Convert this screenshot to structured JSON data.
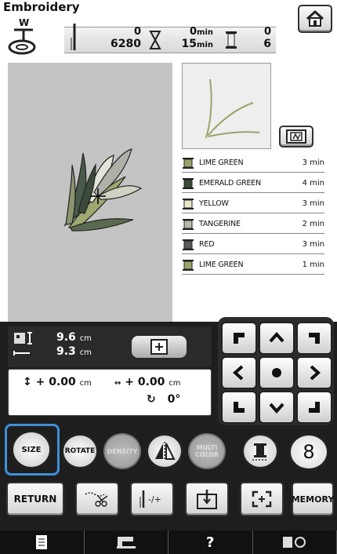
{
  "title": "Embroidery",
  "foot_label": "W",
  "status": {
    "stitch_current": "0",
    "stitch_total": "6280",
    "time_current": "0",
    "time_total": "15",
    "time_unit": "min",
    "color_current": "0",
    "color_total": "6"
  },
  "threads": [
    {
      "name": "LIME GREEN",
      "time": "3 min",
      "color": "#9aa46a"
    },
    {
      "name": "EMERALD GREEN",
      "time": "4 min",
      "color": "#3b4c3a"
    },
    {
      "name": "YELLOW",
      "time": "3 min",
      "color": "#e8e8c8"
    },
    {
      "name": "TANGERINE",
      "time": "2 min",
      "color": "#b8b8b0"
    },
    {
      "name": "RED",
      "time": "3 min",
      "color": "#5a5a5a"
    },
    {
      "name": "LIME GREEN",
      "time": "1 min",
      "color": "#9aa46a"
    }
  ],
  "size": {
    "height": "9.6",
    "width": "9.3",
    "unit": "cm"
  },
  "offset": {
    "vertical": "+ 0.00",
    "horizontal": "+ 0.00",
    "unit": "cm",
    "rotation": "0°"
  },
  "edit_buttons": {
    "size": "SIZE",
    "rotate": "ROTATE",
    "density": "DENSITY",
    "multi_color": "MULTI COLOR",
    "number": "8"
  },
  "action_buttons": {
    "return": "RETURN",
    "memory": "MEMORY"
  },
  "colors": {
    "preview_bg": "#c4c4c4",
    "panel_bg": "#1e1e1e",
    "highlight": "#3f8fd8"
  }
}
